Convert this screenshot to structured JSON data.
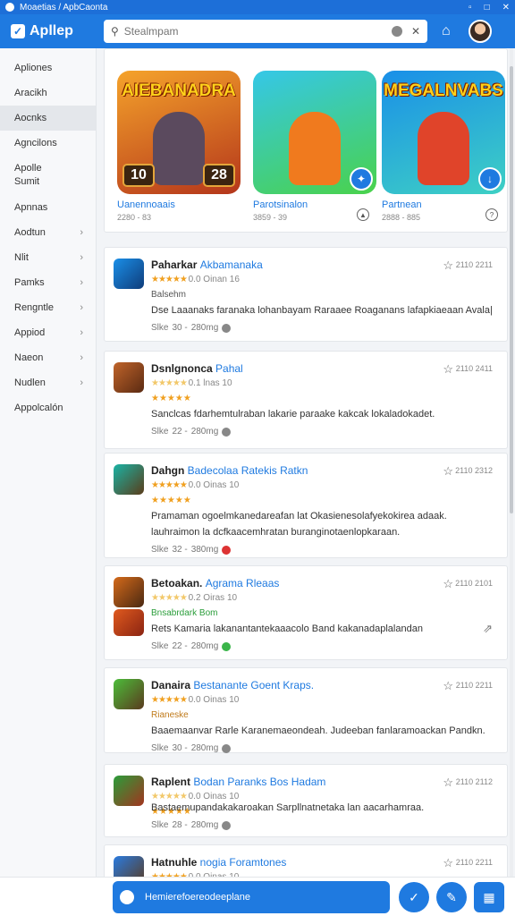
{
  "window": {
    "title": "Moaetias / ApbCaonta"
  },
  "appbar": {
    "brand": "Apllep",
    "search_placeholder": "Stealmpam"
  },
  "sidebar": {
    "items": [
      {
        "label": "Apliones",
        "chevron": false,
        "active": false
      },
      {
        "label": "Aracikh",
        "chevron": false,
        "active": false
      },
      {
        "label": "Aocnks",
        "chevron": false,
        "active": true
      },
      {
        "label": "Agncilons",
        "chevron": false,
        "active": false
      },
      {
        "label": "Apolle Sumit",
        "chevron": false,
        "active": false
      },
      {
        "label": "Apnnas",
        "chevron": false,
        "active": false
      },
      {
        "label": "Aodtun",
        "chevron": true,
        "active": false
      },
      {
        "label": "Nlit",
        "chevron": true,
        "active": false
      },
      {
        "label": "Pamks",
        "chevron": true,
        "active": false
      },
      {
        "label": "Rengntle",
        "chevron": true,
        "active": false
      },
      {
        "label": "Appiod",
        "chevron": true,
        "active": false
      },
      {
        "label": "Naeon",
        "chevron": true,
        "active": false
      },
      {
        "label": "Nudlen",
        "chevron": true,
        "active": false
      },
      {
        "label": "Appolcalón",
        "chevron": false,
        "active": false
      }
    ]
  },
  "featured": [
    {
      "art_title": "AIEBANADRA",
      "name": "Uanennoaais",
      "sub": "2280 - 83",
      "badge_left": "10",
      "badge_right": "28",
      "colors": [
        "#f5a32b",
        "#b4361b"
      ]
    },
    {
      "art_title": "",
      "name": "Parotsinalon",
      "sub": "3859 - 39",
      "colors": [
        "#35c7e8",
        "#4ad24b"
      ]
    },
    {
      "art_title": "MEGALNVABS",
      "name": "Partnean",
      "sub": "2888 - 885",
      "colors": [
        "#1a8fe8",
        "#3ed0c4"
      ]
    }
  ],
  "list": [
    {
      "name": "Paharkar",
      "highlight": "Akbamanaka",
      "date": "2110 2211",
      "rating_text": "0.0 Oinan 16",
      "sub": "Balsehm",
      "sub_color": "#555",
      "desc": [
        "Dse Laaanaks faranaka lohanbayam Raraaee Roaganans lafapkiaeaan Avala|"
      ],
      "size": "Slke",
      "n1": "30",
      "n2": "280mg",
      "dot": "#888",
      "icon_colors": [
        "#1a8fe8",
        "#0f3c7a"
      ]
    },
    {
      "name": "Dsnlgnonca",
      "highlight": "Pahal",
      "date": "2110 2411",
      "rating_text": "0.1 lnas 10",
      "sub": "",
      "sub_color": "#555",
      "desc": [
        "Sanclcas fdarhemtulraban lakarie paraake kakcak lokaladokadet."
      ],
      "size": "Slke",
      "n1": "22",
      "n2": "280mg",
      "dot": "#888",
      "icon_colors": [
        "#c0642a",
        "#5a2a12"
      ]
    },
    {
      "name": "Dahgn",
      "highlight": "Badecolaa Ratekis Ratkn",
      "date": "2110 2312",
      "rating_text": "0.0 Oinas 10",
      "sub": "",
      "sub_color": "#555",
      "desc": [
        "Pramaman ogoelmkanedareafan lat Okasienesolafyekokirea adaak.",
        "lauhraimon la dcfkaacemhratan buranginotaenlopkaraan."
      ],
      "size": "Slke",
      "n1": "32",
      "n2": "380mg",
      "dot": "#d33",
      "icon_colors": [
        "#1ab3a4",
        "#5a3c1a"
      ]
    },
    {
      "name": "Betoakan.",
      "highlight": "Agrama Rleaas",
      "date": "2110 2101",
      "rating_text": "0.2 Oiras 10",
      "sub": "Bnsabrdark Bom",
      "sub_color": "#2a9d3a",
      "desc": [
        "Rets Kamaria lakanantantekaaacolo Band kakanadaplalandan"
      ],
      "size": "Slke",
      "n1": "22",
      "n2": "280mg",
      "dot": "#3ab54a",
      "icon_colors": [
        "#d46a1a",
        "#4a2812"
      ]
    },
    {
      "name": "Danaira",
      "highlight": "Bestanante Goent Kraps.",
      "date": "2110 2211",
      "rating_text": "0.0 Oinas 10",
      "sub": "Rianeske",
      "sub_color": "#c07a1a",
      "desc": [
        "Baaemaanvar Rarle Karanemaeondeah. Judeeban fanlaramoackan Pandkn."
      ],
      "size": "Slke",
      "n1": "30",
      "n2": "280mg",
      "dot": "#888",
      "icon_colors": [
        "#4cbd3a",
        "#5a3a1e"
      ]
    },
    {
      "name": "Raplent",
      "highlight": "Bodan Paranks Bos Hadam",
      "date": "2110 2112",
      "rating_text": "0.0 Oinas 10",
      "sub": "",
      "sub_color": "#555",
      "desc": [
        "Bastaemupandakakaroakan Sarpllnatnetaka lan aacarhamraa."
      ],
      "size": "Slke",
      "n1": "28",
      "n2": "280mg",
      "dot": "#888",
      "icon_colors": [
        "#2a9d3a",
        "#a2341e"
      ]
    },
    {
      "name": "Hatnuhle",
      "highlight": "nogia Foramtones",
      "date": "2110 2211",
      "rating_text": "0.0 Oinas 10",
      "sub": "",
      "sub_color": "#555",
      "desc": [
        ""
      ],
      "size": "",
      "n1": "",
      "n2": "",
      "dot": "#888",
      "icon_colors": [
        "#2a7be0",
        "#5a3a1e"
      ]
    }
  ],
  "bottombar": {
    "pill_label": "Hemierefoereodeeplane"
  }
}
